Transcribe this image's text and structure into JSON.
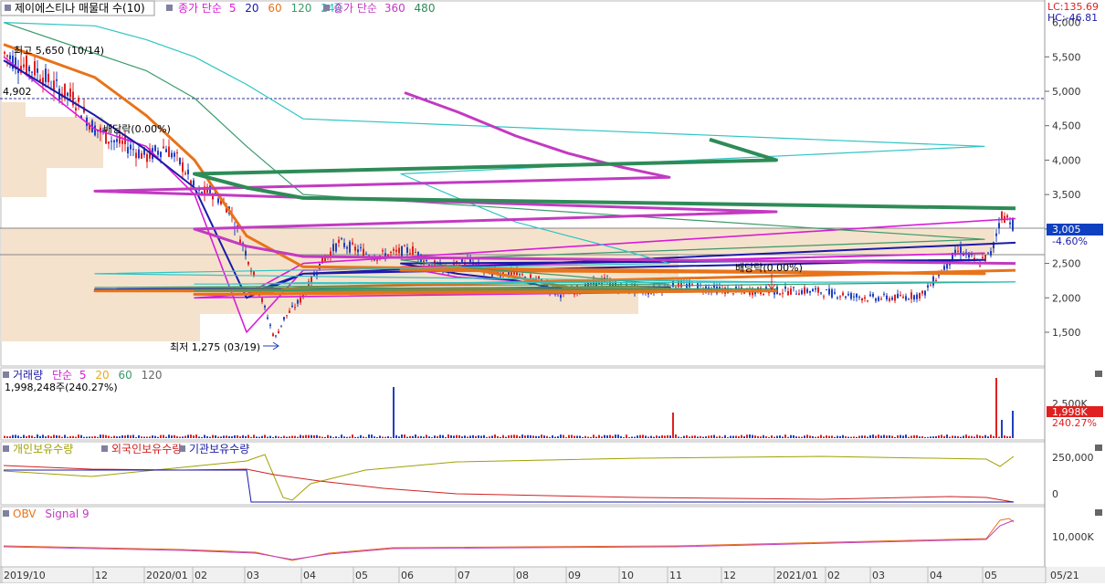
{
  "header": {
    "title": "제이에스티나 매물대 수(10)",
    "price_ma_label": "종가 단순",
    "price_ma_periods": [
      "5",
      "20",
      "60",
      "120",
      "240"
    ],
    "price_ma2_label": "종가 단순",
    "price_ma2_periods": [
      "360",
      "480"
    ],
    "lc": "LC:135.69",
    "hc": "HC:-46.81"
  },
  "colors": {
    "ma5": "#d81bd8",
    "ma20": "#1a1aa8",
    "ma60": "#e8731a",
    "ma120": "#3a9a6a",
    "ma240": "#2ec4c4",
    "ma360": "#c23ac2",
    "ma480": "#2e8b57",
    "up": "#e02020",
    "down": "#2040c0",
    "volume_profile": "#f5e2cc",
    "current_price_box": "#1040c0"
  },
  "price_panel": {
    "y_ticks": [
      "5,500",
      "5,000",
      "4,500",
      "4,000",
      "3,500",
      "3,000",
      "2,500",
      "2,000",
      "1,500"
    ],
    "top_partial_tick": "6,000",
    "high_label": "최고 5,650 (10/14)",
    "low_label": "최저 1,275 (03/19)",
    "ref_price_label": "4,902",
    "dividend_label_1": "배당락(0.00%)",
    "dividend_label_2": "배당락(0.00%)",
    "current_price": "3,005",
    "current_change": "-4.60%"
  },
  "volume_panel": {
    "label": "거래량",
    "ma_label": "단순",
    "ma_periods": [
      "5",
      "20",
      "60",
      "120"
    ],
    "value_text": "1,998,248주(240.27%)",
    "axis_tick": "2,500K",
    "current_value": "1,998K",
    "current_pct": "240.27%"
  },
  "holdings_panel": {
    "labels": [
      "개인보유수량",
      "외국인보유수량",
      "기관보유수량"
    ],
    "axis_ticks": [
      "250,000",
      "0"
    ]
  },
  "obv_panel": {
    "labels": [
      "OBV",
      "Signal 9"
    ],
    "axis_tick": "10,000K"
  },
  "x_axis": {
    "labels": [
      "2019/10",
      "12",
      "2020/01",
      "02",
      "03",
      "04",
      "05",
      "06",
      "07",
      "08",
      "09",
      "10",
      "11",
      "12",
      "2021/01",
      "02",
      "03",
      "04",
      "05",
      "05/21"
    ]
  },
  "chart_data": {
    "type": "line",
    "title": "제이에스티나 매물대 수(10)",
    "y_range": [
      1000,
      6000
    ],
    "series": [
      {
        "name": "종가 단순 5",
        "x": [
          "2019/10",
          "12",
          "2020/01",
          "02",
          "03",
          "04",
          "05",
          "06",
          "07",
          "08",
          "09",
          "10",
          "11",
          "12",
          "2021/01",
          "02",
          "03",
          "04",
          "05"
        ],
        "values": [
          5500,
          4450,
          4200,
          3500,
          1500,
          2400,
          2650,
          2450,
          2300,
          2250,
          2100,
          2150,
          2150,
          2100,
          2100,
          2000,
          2050,
          2500,
          3150
        ]
      },
      {
        "name": "종가 단순 20",
        "x": [
          "2019/10",
          "12",
          "2020/01",
          "02",
          "03",
          "04",
          "05",
          "06",
          "07",
          "08",
          "09",
          "10",
          "11",
          "12",
          "2021/01",
          "02",
          "03",
          "04",
          "05"
        ],
        "values": [
          5450,
          4650,
          4150,
          3600,
          2000,
          2350,
          2550,
          2500,
          2350,
          2250,
          2100,
          2150,
          2150,
          2120,
          2100,
          2050,
          2050,
          2350,
          2800
        ]
      },
      {
        "name": "종가 단순 60",
        "x": [
          "2019/10",
          "12",
          "2020/01",
          "02",
          "03",
          "04",
          "05",
          "06",
          "07",
          "08",
          "09",
          "10",
          "11",
          "12",
          "2021/01",
          "02",
          "03",
          "04",
          "05"
        ],
        "values": [
          5680,
          5200,
          4650,
          4000,
          2900,
          2450,
          2350,
          2400,
          2450,
          2300,
          2150,
          2150,
          2130,
          2100,
          2100,
          2050,
          2050,
          2150,
          2400
        ]
      },
      {
        "name": "종가 단순 120",
        "x": [
          "2019/10",
          "12",
          "2020/01",
          "02",
          "03",
          "04",
          "05",
          "06",
          "07",
          "08",
          "09",
          "10",
          "11",
          "12",
          "2021/01",
          "02",
          "03",
          "04",
          "05"
        ],
        "values": [
          6000,
          5550,
          5300,
          4900,
          4200,
          3500,
          2850,
          2550,
          2450,
          2380,
          2320,
          2250,
          2200,
          2150,
          2130,
          2100,
          2100,
          2120,
          2230
        ]
      },
      {
        "name": "종가 단순 240",
        "x": [
          "2019/10",
          "12",
          "2020/01",
          "02",
          "03",
          "04",
          "05",
          "06",
          "07",
          "08",
          "09",
          "10",
          "11",
          "12",
          "2021/01",
          "02",
          "03",
          "04",
          "05"
        ],
        "values": [
          6000,
          5950,
          5750,
          5500,
          5100,
          4600,
          4200,
          3800,
          3450,
          3100,
          2900,
          2700,
          2500,
          2350,
          2230,
          2200,
          2200,
          2220,
          2230
        ]
      },
      {
        "name": "종가 단순 360",
        "x": [
          "06",
          "07",
          "08",
          "09",
          "10",
          "11",
          "12",
          "2021/01",
          "02",
          "03",
          "04",
          "05"
        ],
        "values": [
          4980,
          4700,
          4350,
          4100,
          3900,
          3750,
          3550,
          3250,
          3000,
          2750,
          2600,
          2500
        ]
      },
      {
        "name": "종가 단순 480",
        "x": [
          "12",
          "2021/01",
          "02",
          "03",
          "04",
          "05"
        ],
        "values": [
          4300,
          4000,
          3800,
          3600,
          3450,
          3300
        ]
      }
    ],
    "annotations": [
      {
        "text": "최고 5,650 (10/14)",
        "x": "2019/10",
        "y": 5650
      },
      {
        "text": "최저 1,275 (03/19)",
        "x": "03",
        "y": 1275
      },
      {
        "text": "배당락(0.00%)",
        "x": "12",
        "y": 4300
      },
      {
        "text": "배당락(0.00%)",
        "x": "12",
        "y": 2100
      }
    ],
    "reference_line": 4902,
    "last_price": 3005,
    "last_change_pct": -4.6,
    "volume_last": "1,998,248주",
    "volume_last_pct": 240.27
  }
}
